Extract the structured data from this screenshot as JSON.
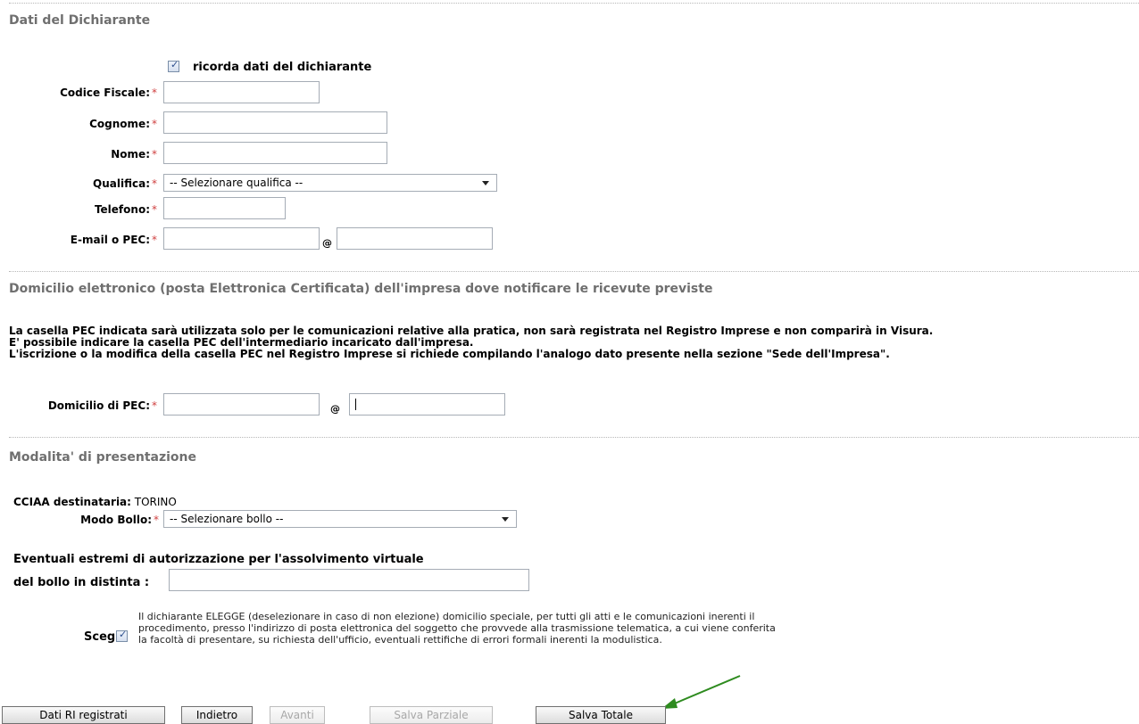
{
  "sections": {
    "declarant_title": "Dati del Dichiarante",
    "pec_title": "Domicilio elettronico (posta Elettronica Certificata) dell'impresa dove notificare le ricevute previste",
    "presentation_title": "Modalita' di presentazione"
  },
  "declarant": {
    "remember_label": "ricorda dati del dichiarante",
    "codice_fiscale_label": "Codice Fiscale:",
    "cognome_label": "Cognome:",
    "nome_label": "Nome:",
    "qualifica_label": "Qualifica:",
    "qualifica_selected": "-- Selezionare qualifica --",
    "telefono_label": "Telefono:",
    "email_label": "E-mail o PEC:",
    "at_sign": "@",
    "required_mark": "*"
  },
  "pec": {
    "info_line1": "La casella PEC indicata sarà utilizzata solo per le comunicazioni relative alla pratica, non sarà registrata nel Registro Imprese e non comparirà in Visura.",
    "info_line2": "E' possibile indicare la casella PEC dell'intermediario incaricato dall'impresa.",
    "info_line3": "L'iscrizione o la modifica della casella PEC nel Registro Imprese si richiede compilando l'analogo dato presente nella sezione \"Sede dell'Impresa\".",
    "domicilio_label": "Domicilio di PEC:"
  },
  "presentation": {
    "cciaa_label": "CCIAA destinataria:",
    "cciaa_value": "TORINO",
    "bollo_label": "Modo Bollo:",
    "bollo_selected": "-- Selezionare bollo --",
    "estremi_line1": "Eventuali estremi di autorizzazione per l'assolvimento virtuale",
    "estremi_line2": "del bollo in distinta :",
    "scegli_label": "Scegli",
    "elegge_line1": "Il dichiarante ELEGGE (deselezionare in caso di non elezione) domicilio speciale, per tutti gli atti e le comunicazioni inerenti il",
    "elegge_line2": "procedimento, presso l'indirizzo di posta elettronica del soggetto che provvede alla trasmissione telematica, a cui viene conferita",
    "elegge_line3": "la facoltà di presentare, su richiesta dell'ufficio, eventuali rettifiche di errori formali inerenti la modulistica."
  },
  "buttons": {
    "dati_ri": "Dati RI registrati",
    "indietro": "Indietro",
    "avanti": "Avanti",
    "salva_parziale": "Salva Parziale",
    "salva_totale": "Salva Totale"
  },
  "colors": {
    "arrow": "#2e8b1f",
    "section_title": "#6f6f6f",
    "required": "#d04040"
  }
}
